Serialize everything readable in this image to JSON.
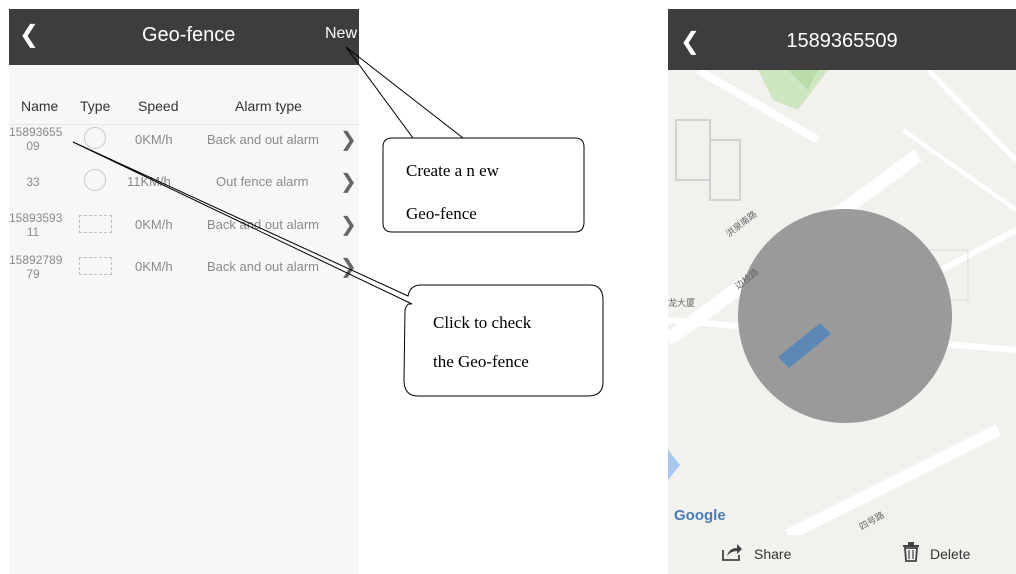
{
  "left_screen": {
    "title": "Geo-fence",
    "new_label": "New",
    "columns": [
      "Name",
      "Type",
      "Speed",
      "Alarm type"
    ],
    "rows": [
      {
        "name_line1": "15893655",
        "name_line2": "09",
        "type_shape": "circle",
        "speed": "0KM/h",
        "alarm": "Back and out alarm"
      },
      {
        "name_line1": "33",
        "name_line2": "",
        "type_shape": "circle",
        "speed": "11KM/h",
        "alarm": "Out fence alarm"
      },
      {
        "name_line1": "15893593",
        "name_line2": "11",
        "type_shape": "rectangle",
        "speed": "0KM/h",
        "alarm": "Back and out alarm"
      },
      {
        "name_line1": "15892789",
        "name_line2": "79",
        "type_shape": "rectangle",
        "speed": "0KM/h",
        "alarm": "Back and out alarm"
      }
    ]
  },
  "callouts": {
    "new_line1": "Create a n    ew",
    "new_line2": "Geo-fence",
    "check_line1": "Click to check",
    "check_line2": "the Geo-fence"
  },
  "right_screen": {
    "title": "1589365509",
    "map_labels": [
      "洪泉南路",
      "边检路",
      "龙大厦",
      "四号路"
    ],
    "google": "Google",
    "share_label": "Share",
    "delete_label": "Delete"
  },
  "colors": {
    "topbar": "#3d3d3d",
    "fence_fill": "#9a9a9a",
    "building": "#5d87b4"
  }
}
